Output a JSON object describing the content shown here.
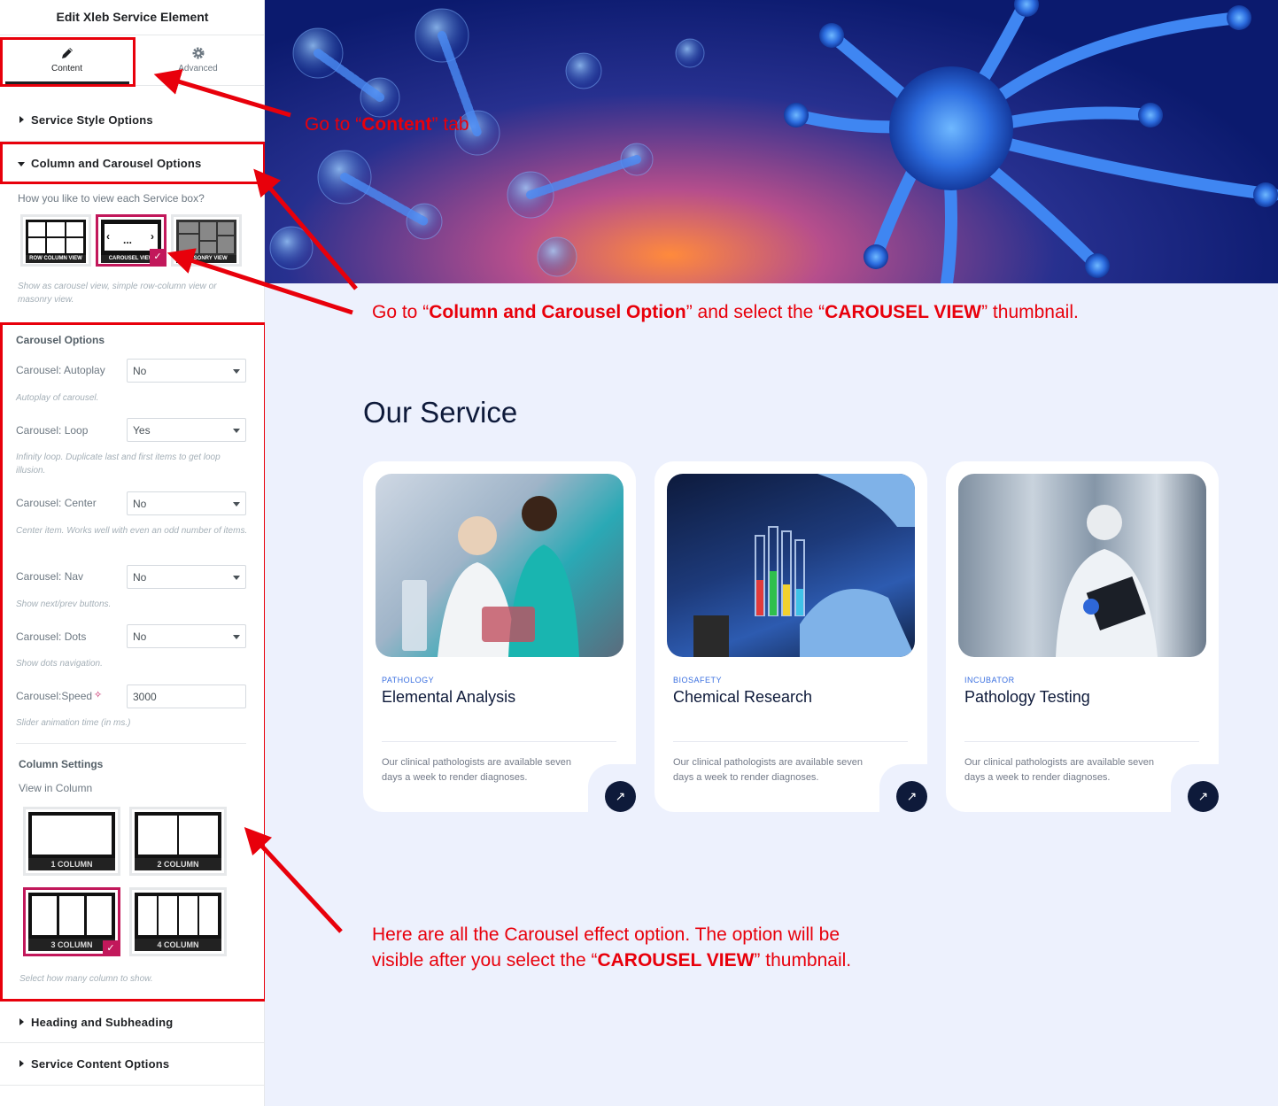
{
  "panel": {
    "title": "Edit Xleb Service Element",
    "tabs": [
      {
        "label": "Content",
        "icon": "pencil-icon"
      },
      {
        "label": "Advanced",
        "icon": "gear-icon"
      }
    ]
  },
  "sections": {
    "service_style": "Service Style Options",
    "column_carousel": "Column and Carousel Options",
    "heading_subheading": "Heading and Subheading",
    "service_content": "Service Content Options"
  },
  "view_choice": {
    "question": "How you like to view each Service box?",
    "options": [
      "ROW COLUMN VIEW",
      "CAROUSEL VIEW",
      "MASONRY VIEW"
    ],
    "selected": "CAROUSEL VIEW",
    "help": "Show as carousel view, simple row-column view or masonry view."
  },
  "carousel_options": {
    "heading": "Carousel Options",
    "fields": [
      {
        "label": "Carousel: Autoplay",
        "value": "No",
        "help": "Autoplay of carousel."
      },
      {
        "label": "Carousel: Loop",
        "value": "Yes",
        "help": "Infinity loop. Duplicate last and first items to get loop illusion."
      },
      {
        "label": "Carousel: Center",
        "value": "No",
        "help": "Center item. Works well with even an odd number of items."
      },
      {
        "label": "Carousel: Nav",
        "value": "No",
        "help": "Show next/prev buttons."
      },
      {
        "label": "Carousel: Dots",
        "value": "No",
        "help": "Show dots navigation."
      }
    ],
    "speed": {
      "label": "Carousel:Speed",
      "value": "3000",
      "help": "Slider animation time (in ms.)"
    }
  },
  "column_settings": {
    "heading": "Column Settings",
    "label": "View in Column",
    "options": [
      "1 COLUMN",
      "2 COLUMN",
      "3 COLUMN",
      "4 COLUMN"
    ],
    "selected": "3 COLUMN",
    "help": "Select how many column to show."
  },
  "main": {
    "title": "Our Service",
    "cards": [
      {
        "category": "PATHOLOGY",
        "title": "Elemental Analysis",
        "description": "Our clinical pathologists are available seven days a week to render diagnoses."
      },
      {
        "category": "BIOSAFETY",
        "title": "Chemical Research",
        "description": "Our clinical pathologists are available seven days a week to render diagnoses."
      },
      {
        "category": "INCUBATOR",
        "title": "Pathology Testing",
        "description": "Our clinical pathologists are available seven days a week to render diagnoses."
      }
    ]
  },
  "annotations": {
    "a1": {
      "pre": "Go  to “",
      "bold": "Content",
      "post": "” tab"
    },
    "a2": {
      "p1": "Go to “",
      "b1": "Column and Carousel Option",
      "p2": "” and select the “",
      "b2": "CAROUSEL VIEW",
      "p3": "” thumbnail."
    },
    "a3": {
      "line1": "Here are all the Carousel effect option. The option will be",
      "p1": "visible after you select the “",
      "b1": "CAROUSEL VIEW",
      "p2": "” thumbnail."
    }
  },
  "colors": {
    "accent": "#c2185b",
    "annotation": "#e8000b",
    "navy": "#0e1a3a",
    "page_bg": "#edf1fd"
  }
}
